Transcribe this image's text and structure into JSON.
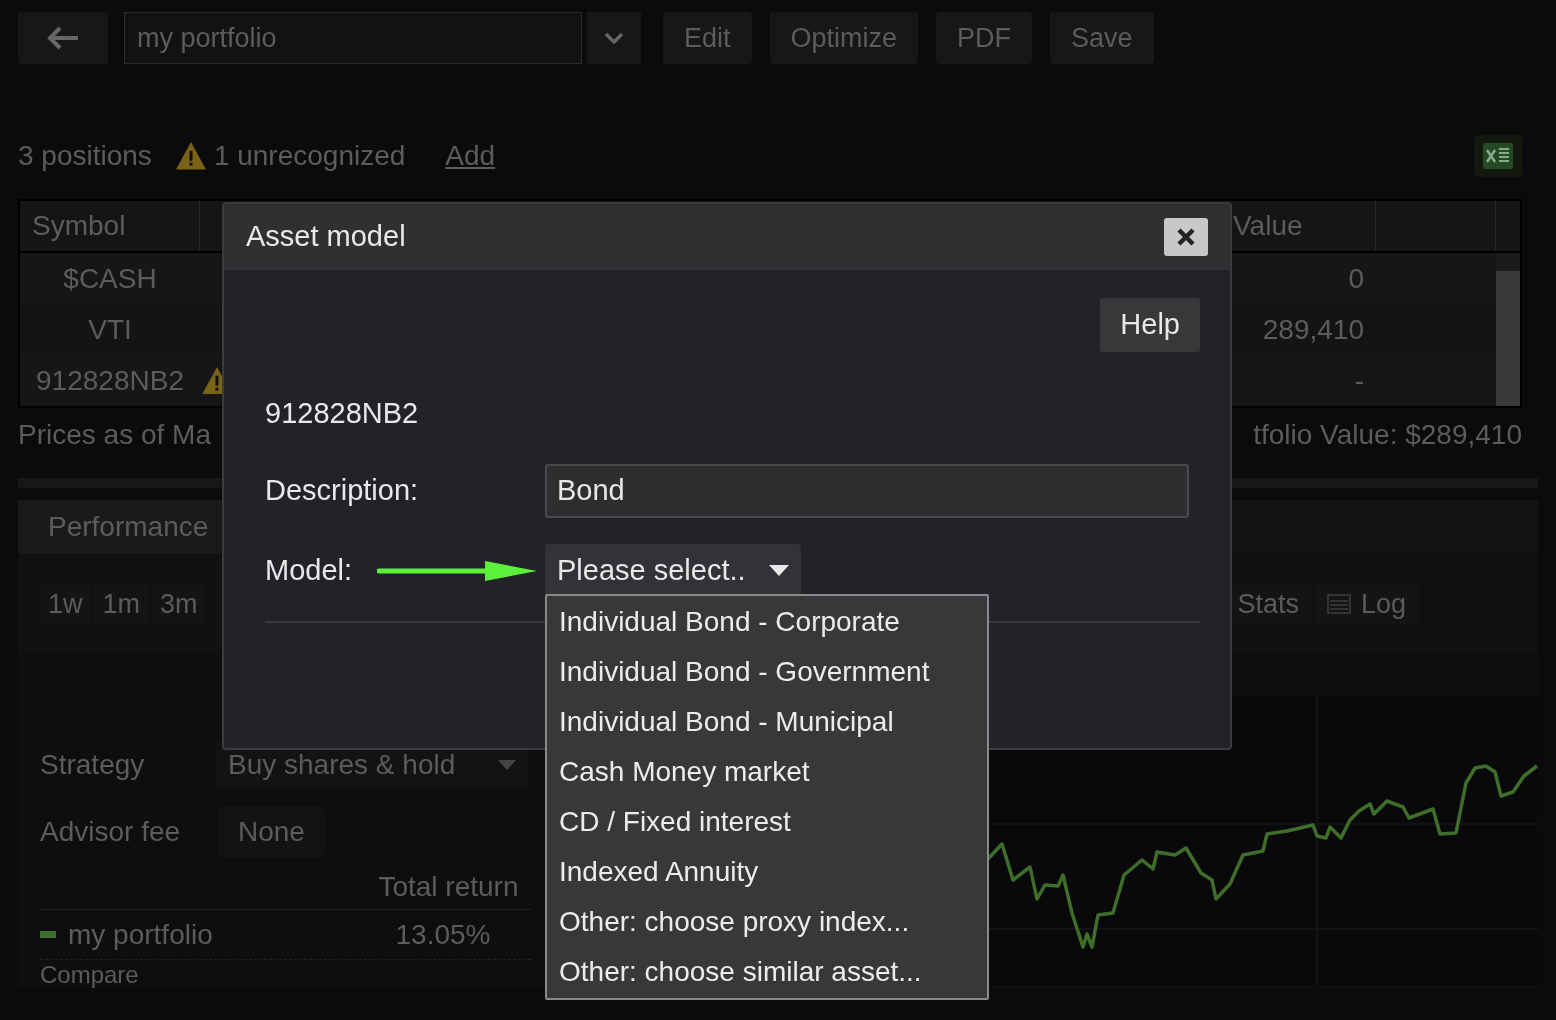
{
  "toolbar": {
    "portfolio_field": {
      "value": "my portfolio"
    },
    "buttons": [
      "Edit",
      "Optimize",
      "PDF",
      "Save"
    ]
  },
  "summary": {
    "positions": "3 positions",
    "unrecognized": "1 unrecognized",
    "add_link": "Add"
  },
  "table": {
    "columns": [
      "Symbol",
      "Value"
    ],
    "rows": [
      {
        "symbol": "$CASH",
        "value": "0",
        "warning": false
      },
      {
        "symbol": "VTI",
        "value": "289,410",
        "warning": false
      },
      {
        "symbol": "912828NB2",
        "value": "-",
        "warning": true
      }
    ]
  },
  "prices_note": "Prices as of Ma",
  "portfolio_value": "tfolio Value: $289,410",
  "performance": {
    "tab": "Performance",
    "periods": [
      "1w",
      "1m",
      "3m"
    ],
    "views": [
      {
        "label": "Stats",
        "kind": "plain"
      },
      {
        "label": "Log",
        "kind": "with-icon"
      }
    ],
    "strategy": {
      "label": "Strategy",
      "value": "Buy shares & hold"
    },
    "advisor_fee": {
      "label": "Advisor fee",
      "value": "None"
    },
    "returns": {
      "column": "Total return",
      "rows": [
        {
          "name": "my portfolio",
          "value": "13.05%",
          "color": "#3f6e2a"
        }
      ]
    },
    "compare": "Compare"
  },
  "dialog": {
    "title": "Asset model",
    "help": "Help",
    "symbol": "912828NB2",
    "description": {
      "label": "Description:",
      "value": "Bond"
    },
    "model": {
      "label": "Model:",
      "value": "Please select..",
      "expanded": true,
      "options": [
        {
          "label": "Individual Bond - Corporate",
          "selected": false
        },
        {
          "label": "Individual Bond - Government",
          "selected": false
        },
        {
          "label": "Individual Bond - Municipal",
          "selected": false
        },
        {
          "label": "Cash Money market",
          "selected": false
        },
        {
          "label": "CD / Fixed interest",
          "selected": false
        },
        {
          "label": "Indexed Annuity",
          "selected": false
        },
        {
          "label": "Other: choose proxy index...",
          "selected": false
        },
        {
          "label": "Other: choose similar asset...",
          "selected": false
        }
      ]
    }
  }
}
